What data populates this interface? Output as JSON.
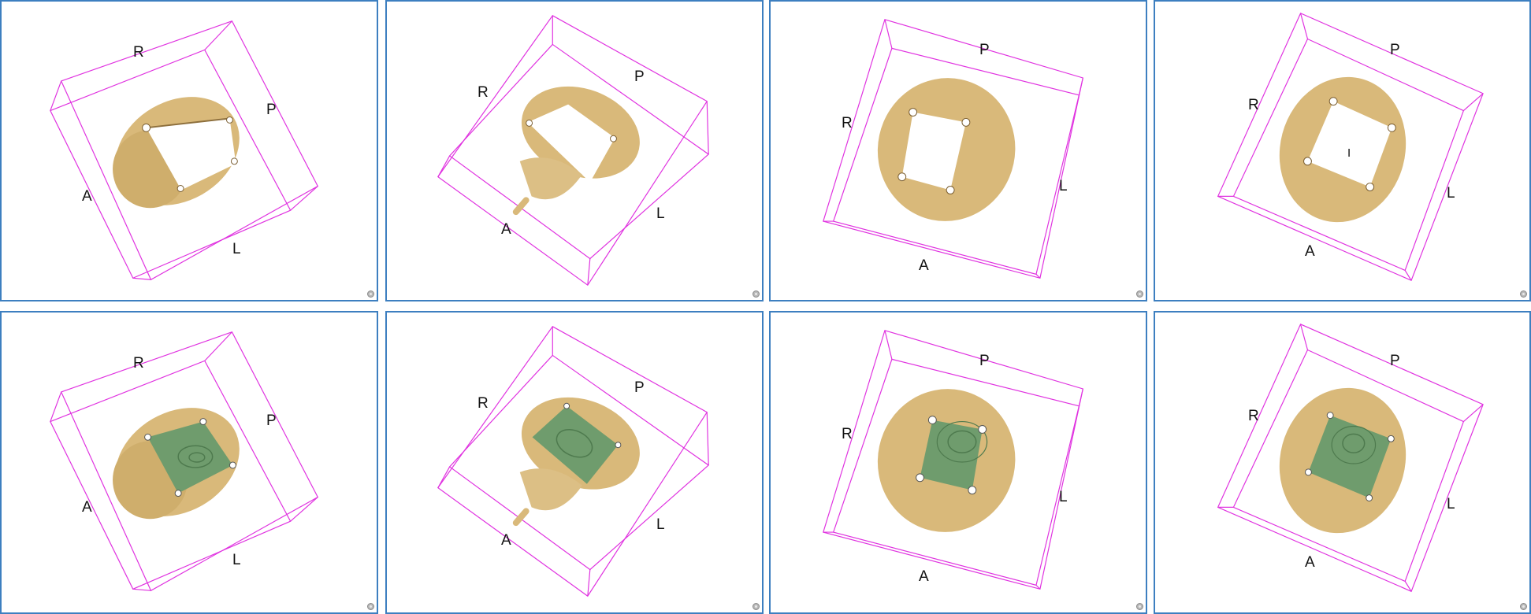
{
  "colors": {
    "panel_border": "#3d7fc0",
    "bounding_box": "#e033e0",
    "skull": "#d9b97a",
    "skull_shade": "#a8884f",
    "implant": "#6f9c6d",
    "implant_shade": "#4e7a4e"
  },
  "views": [
    {
      "row": "top",
      "labels": {
        "r": "R",
        "p": "P",
        "a": "A",
        "l": "L"
      },
      "implant": false
    },
    {
      "row": "top",
      "labels": {
        "r": "R",
        "p": "P",
        "a": "A",
        "l": "L"
      },
      "implant": false
    },
    {
      "row": "top",
      "labels": {
        "r": "R",
        "p": "P",
        "a": "A",
        "l": "L"
      },
      "implant": false
    },
    {
      "row": "top",
      "labels": {
        "r": "R",
        "p": "P",
        "a": "A",
        "l": "L",
        "i": "I"
      },
      "implant": false
    },
    {
      "row": "bottom",
      "labels": {
        "r": "R",
        "p": "P",
        "a": "A",
        "l": "L"
      },
      "implant": true
    },
    {
      "row": "bottom",
      "labels": {
        "r": "R",
        "p": "P",
        "a": "A",
        "l": "L"
      },
      "implant": true
    },
    {
      "row": "bottom",
      "labels": {
        "r": "R",
        "p": "P",
        "a": "A",
        "l": "L"
      },
      "implant": true
    },
    {
      "row": "bottom",
      "labels": {
        "r": "R",
        "p": "P",
        "a": "A",
        "l": "L"
      },
      "implant": true
    }
  ],
  "icons": {
    "corner": "view-reset-icon"
  }
}
